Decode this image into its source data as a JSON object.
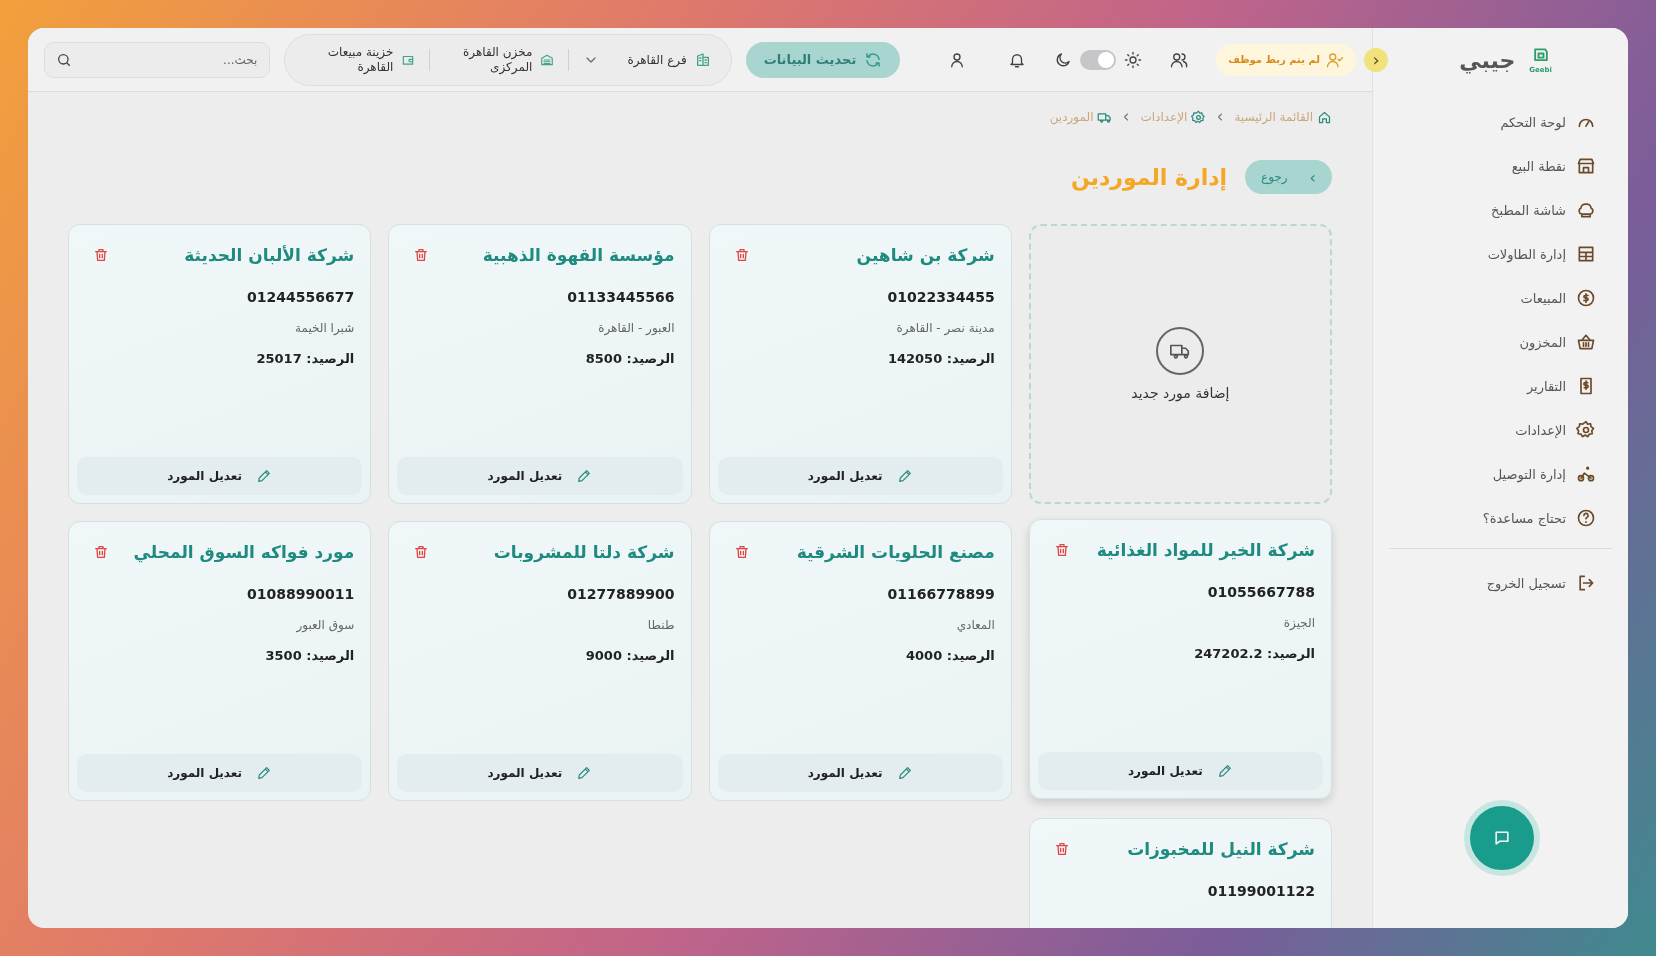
{
  "sidebar": {
    "logo_text": "جيبي",
    "logo_mark": "Geebi",
    "collapse_glyph": "‹",
    "items": [
      {
        "label": "لوحة التحكم"
      },
      {
        "label": "نقطة البيع"
      },
      {
        "label": "شاشة المطبخ"
      },
      {
        "label": "إدارة الطاولات"
      },
      {
        "label": "المبيعات"
      },
      {
        "label": "المخزون"
      },
      {
        "label": "التقارير"
      },
      {
        "label": "الإعدادات"
      },
      {
        "label": "إدارة التوصيل"
      },
      {
        "label": "تحتاج مساعدة؟"
      }
    ],
    "logout": "تسجيل الخروج"
  },
  "topbar": {
    "staff_badge": "لم يتم ربط موظف",
    "light_mode": true,
    "refresh_button": "تحديث البيانات",
    "branch": "فرع القاهرة",
    "warehouse": "مخزن القاهرة المركزى",
    "cashbox": "خزينة مبيعات القاهرة",
    "search": {
      "placeholder": "بحث..."
    }
  },
  "breadcrumb": [
    {
      "label": "القائمة الرئيسية"
    },
    {
      "label": "الإعدادات"
    },
    {
      "label": "الموردين"
    }
  ],
  "page": {
    "title": "إدارة الموردين",
    "back_button": "رجوع",
    "back_glyph": "›",
    "add_card": "إضافة مورد جديد"
  },
  "suppliers": [
    {
      "name": "شركة بن شاهين",
      "phone": "01022334455",
      "address": "مدينة نصر - القاهرة",
      "balance": "الرصيد: 142050",
      "edit_label": "تعديل المورد",
      "hovered": false
    },
    {
      "name": "مؤسسة القهوة الذهبية",
      "phone": "01133445566",
      "address": "العبور - القاهرة",
      "balance": "الرصيد: 8500",
      "edit_label": "تعديل المورد",
      "hovered": false
    },
    {
      "name": "شركة الألبان الحديثة",
      "phone": "01244556677",
      "address": "شبرا الخيمة",
      "balance": "الرصيد: 25017",
      "edit_label": "تعديل المورد",
      "hovered": false
    },
    {
      "name": "شركة الخير للمواد الغذائية",
      "phone": "01055667788",
      "address": "الجيزة",
      "balance": "الرصيد: 247202.2",
      "edit_label": "تعديل المورد",
      "hovered": true
    },
    {
      "name": "مصنع الحلويات الشرقية",
      "phone": "01166778899",
      "address": "المعادي",
      "balance": "الرصيد: 4000",
      "edit_label": "تعديل المورد",
      "hovered": false
    },
    {
      "name": "شركة دلتا للمشروبات",
      "phone": "01277889900",
      "address": "طنطا",
      "balance": "الرصيد: 9000",
      "edit_label": "تعديل المورد",
      "hovered": false
    },
    {
      "name": "مورد فواكه السوق المحلي",
      "phone": "01088990011",
      "address": "سوق العبور",
      "balance": "الرصيد: 3500",
      "edit_label": "تعديل المورد",
      "hovered": false
    },
    {
      "name": "شركة النيل للمخبوزات",
      "phone": "01199001122",
      "hovered": false
    }
  ]
}
